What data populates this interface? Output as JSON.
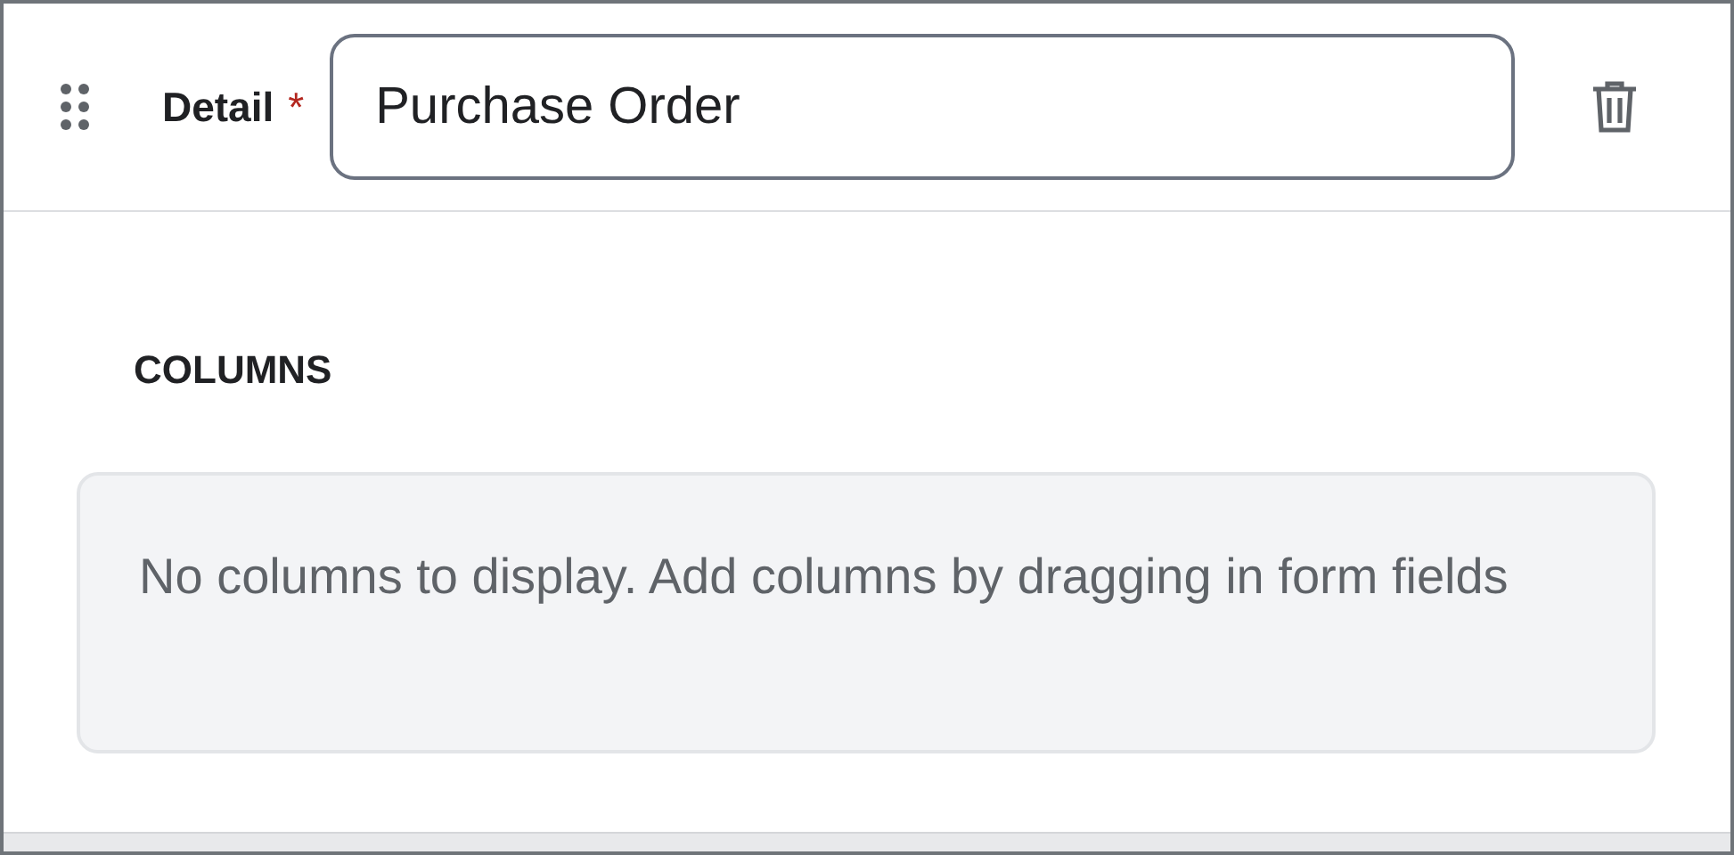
{
  "detail": {
    "label": "Detail",
    "required_mark": "*",
    "value": "Purchase Order"
  },
  "columns": {
    "heading": "COLUMNS",
    "empty_message": "No columns to display. Add columns by dragging in form fields"
  }
}
